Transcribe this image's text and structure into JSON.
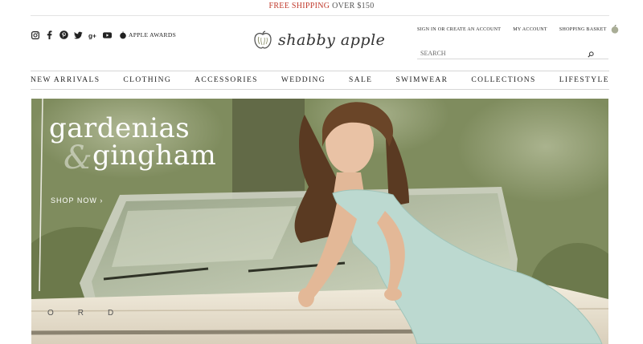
{
  "promo": {
    "highlight": "FREE SHIPPING",
    "rest": " OVER $150"
  },
  "social": {
    "icons": [
      "instagram-icon",
      "facebook-icon",
      "pinterest-icon",
      "twitter-icon",
      "google-plus-icon",
      "youtube-icon",
      "apple-awards-icon"
    ],
    "awards_label": "APPLE AWARDS"
  },
  "logo": {
    "text": "shabby apple"
  },
  "account": {
    "signin": "SIGN IN OR CREATE AN ACCOUNT",
    "my_account": "MY ACCOUNT",
    "basket": "SHOPPING BASKET"
  },
  "search": {
    "placeholder": "SEARCH"
  },
  "nav": [
    "NEW ARRIVALS",
    "CLOTHING",
    "ACCESSORIES",
    "WEDDING",
    "SALE",
    "SWIMWEAR",
    "COLLECTIONS",
    "LIFESTYLE"
  ],
  "hero": {
    "title_line1": "gardenias",
    "ampersand": "&",
    "title_line2": "gingham",
    "cta": "SHOP NOW ›"
  },
  "colors": {
    "promo_highlight": "#c0392b",
    "hero_text": "#ffffff"
  }
}
